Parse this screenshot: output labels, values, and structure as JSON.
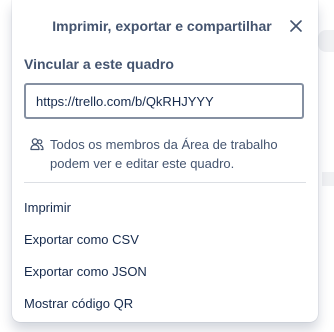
{
  "popover": {
    "title": "Imprimir, exportar e compartilhar",
    "close_icon": "close-icon",
    "link_section": {
      "label": "Vincular a este quadro",
      "url": "https://trello.com/b/QkRHJYYY"
    },
    "notice": {
      "icon": "members-icon",
      "text": "Todos os membros da Área de trabalho podem ver e editar este quadro."
    },
    "menu_items": [
      {
        "label": "Imprimir"
      },
      {
        "label": "Exportar como CSV"
      },
      {
        "label": "Exportar como JSON"
      },
      {
        "label": "Mostrar código QR"
      }
    ]
  },
  "colors": {
    "heading": "#44546f",
    "text": "#172b4d",
    "input_border": "#8590a2",
    "divider": "#dcdfe4"
  }
}
